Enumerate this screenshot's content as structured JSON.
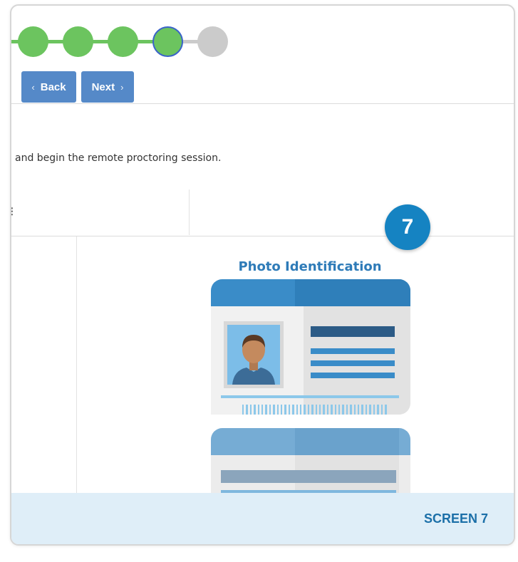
{
  "stepper": {
    "steps": [
      {
        "state": "complete"
      },
      {
        "state": "complete"
      },
      {
        "state": "complete"
      },
      {
        "state": "current"
      },
      {
        "state": "upcoming"
      }
    ],
    "colors": {
      "complete": "#6cc45f",
      "current_border": "#3a63c9",
      "upcoming": "#cbcbcb"
    }
  },
  "nav": {
    "back_label": "Back",
    "next_label": "Next",
    "back_icon": "chevron-left-icon",
    "next_icon": "chevron-right-icon"
  },
  "content": {
    "instruction_text": "and begin the remote proctoring session."
  },
  "callout": {
    "number": "7",
    "color": "#1583c2"
  },
  "illustration": {
    "title": "Photo Identification",
    "icon": "id-card-icon"
  },
  "footer": {
    "label": "SCREEN 7",
    "background": "#dfeef8"
  }
}
